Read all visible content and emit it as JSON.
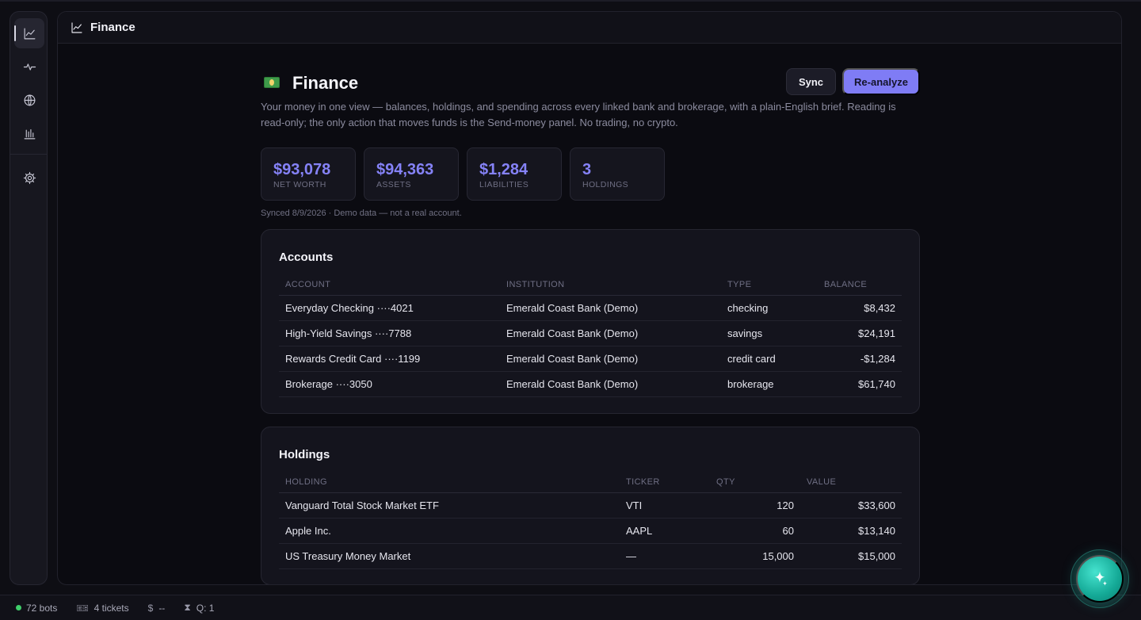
{
  "app": {
    "header_title": "Finance"
  },
  "sidebar": {
    "items": [
      {
        "icon": "chart-line-icon",
        "active": true
      },
      {
        "icon": "pulse-icon",
        "active": false
      },
      {
        "icon": "globe-icon",
        "active": false
      },
      {
        "icon": "bar-chart-icon",
        "active": false
      },
      {
        "icon": "gear-icon",
        "active": false
      }
    ]
  },
  "page": {
    "title": "Finance",
    "subtitle": "Your money in one view — balances, holdings, and spending across every linked bank and brokerage, with a plain-English brief. Reading is read-only; the only action that moves funds is the Send-money panel. No trading, no crypto.",
    "sync_label": "Sync",
    "reanalyze_label": "Re-analyze",
    "synced_text": "Synced 8/9/2026 · Demo data — not a real account."
  },
  "stats": [
    {
      "value": "$93,078",
      "label": "NET WORTH"
    },
    {
      "value": "$94,363",
      "label": "ASSETS"
    },
    {
      "value": "$1,284",
      "label": "LIABILITIES"
    },
    {
      "value": "3",
      "label": "HOLDINGS"
    }
  ],
  "accounts": {
    "title": "Accounts",
    "columns": [
      "ACCOUNT",
      "INSTITUTION",
      "TYPE",
      "BALANCE"
    ],
    "rows": [
      [
        "Everyday Checking ····4021",
        "Emerald Coast Bank (Demo)",
        "checking",
        "$8,432"
      ],
      [
        "High-Yield Savings ····7788",
        "Emerald Coast Bank (Demo)",
        "savings",
        "$24,191"
      ],
      [
        "Rewards Credit Card ····1199",
        "Emerald Coast Bank (Demo)",
        "credit card",
        "-$1,284"
      ],
      [
        "Brokerage ····3050",
        "Emerald Coast Bank (Demo)",
        "brokerage",
        "$61,740"
      ]
    ]
  },
  "holdings": {
    "title": "Holdings",
    "columns": [
      "HOLDING",
      "TICKER",
      "QTY",
      "VALUE"
    ],
    "rows": [
      [
        "Vanguard Total Stock Market ETF",
        "VTI",
        "120",
        "$33,600"
      ],
      [
        "Apple Inc.",
        "AAPL",
        "60",
        "$13,140"
      ],
      [
        "US Treasury Money Market",
        "—",
        "15,000",
        "$15,000"
      ]
    ]
  },
  "statusbar": {
    "bots": "72 bots",
    "tickets": "4 tickets",
    "cost": "--",
    "queue": "Q: 1"
  },
  "colors": {
    "accent": "#7f7cf5",
    "stat_value": "#8582f7",
    "online": "#3fce6a",
    "assistant": "#14a996"
  }
}
